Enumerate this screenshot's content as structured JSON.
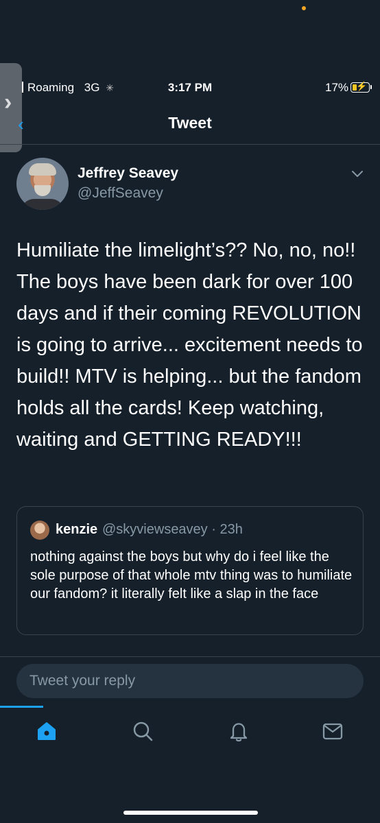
{
  "status_bar": {
    "carrier": "Roaming",
    "network": "3G",
    "time": "3:17 PM",
    "battery": "17%"
  },
  "header": {
    "title": "Tweet"
  },
  "tweet": {
    "author_name": "Jeffrey Seavey",
    "author_handle": "@JeffSeavey",
    "text": "Humiliate the limelight’s??  No, no, no!! The boys have been dark for over 100 days and if their coming REVOLUTION is going to arrive... excitement needs to build!! MTV is helping... but the fandom holds all the cards! Keep watching, waiting and GETTING READY!!!"
  },
  "quoted_tweet": {
    "author_name": "kenzie",
    "author_handle": "@skyviewseavey · 23h",
    "text": "nothing against the boys but why do i feel like the sole purpose of that whole mtv thing was to humiliate our fandom? it literally felt like a slap in the face"
  },
  "reply": {
    "placeholder": "Tweet your reply"
  },
  "nav": {
    "items": [
      "home-icon",
      "search-icon",
      "notifications-icon",
      "messages-icon"
    ],
    "active": "home-icon"
  },
  "colors": {
    "background": "#15202b",
    "accent": "#1da1f2",
    "secondary_text": "#8899a6",
    "divider": "#38444d"
  }
}
